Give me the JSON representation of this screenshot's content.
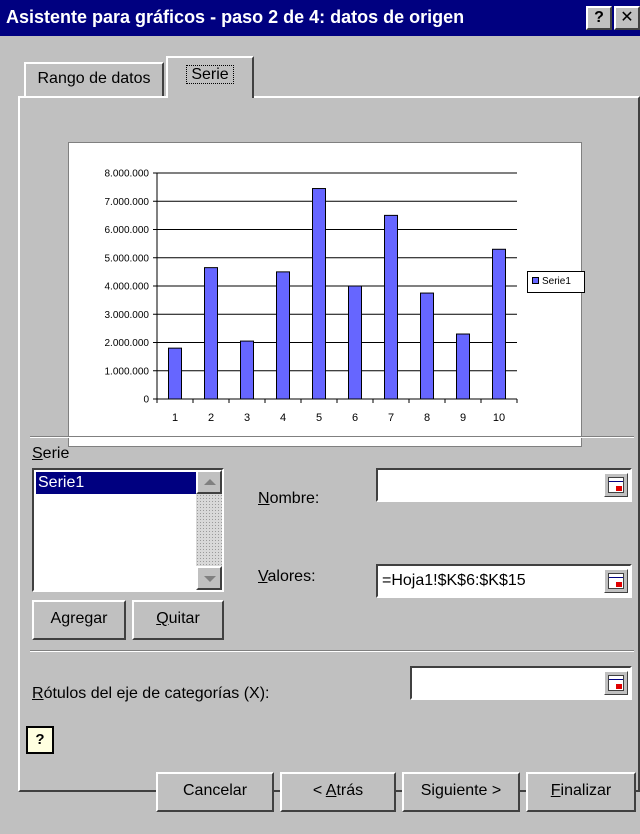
{
  "window": {
    "title": "Asistente para gráficos - paso 2 de 4: datos de origen",
    "help_label": "?",
    "close_label": "✕"
  },
  "tabs": [
    {
      "label": "Rango de datos",
      "selected": false
    },
    {
      "label": "Serie",
      "selected": true
    }
  ],
  "chart_data": {
    "type": "bar",
    "categories": [
      "1",
      "2",
      "3",
      "4",
      "5",
      "6",
      "7",
      "8",
      "9",
      "10"
    ],
    "series": [
      {
        "name": "Serie1",
        "color": "#6666ff",
        "values": [
          1800000,
          4650000,
          2050000,
          4500000,
          7450000,
          4000000,
          6500000,
          3750000,
          2300000,
          5300000
        ]
      }
    ],
    "ylim": [
      0,
      8000000
    ],
    "yticks": [
      "0",
      "1.000.000",
      "2.000.000",
      "3.000.000",
      "4.000.000",
      "5.000.000",
      "6.000.000",
      "7.000.000",
      "8.000.000"
    ],
    "grid": true,
    "legend": "right"
  },
  "series_section": {
    "heading": "Serie",
    "heading_mnemonic": "S",
    "heading_rest": "erie",
    "items": [
      "Serie1"
    ],
    "selected_index": 0
  },
  "buttons": {
    "add": {
      "before": "A",
      "mnemonic": "g",
      "after": "regar"
    },
    "remove": {
      "before": "",
      "mnemonic": "Q",
      "after": "uitar"
    }
  },
  "fields": {
    "name": {
      "label_mnemonic": "N",
      "label_rest": "ombre:",
      "value": ""
    },
    "values": {
      "label_mnemonic": "V",
      "label_rest": "alores:",
      "value": "=Hoja1!$K$6:$K$15"
    },
    "category_labels": {
      "label_mnemonic": "R",
      "label_rest": "ótulos del eje de categorías (X):",
      "value": ""
    }
  },
  "footer": {
    "help_icon": "?",
    "cancel": {
      "before": "Cancelar",
      "mnemonic": "",
      "after": ""
    },
    "back": {
      "before": "< ",
      "mnemonic": "A",
      "after": "trás"
    },
    "next": {
      "before": "Siguiente >",
      "mnemonic": "",
      "after": ""
    },
    "finish": {
      "before": "",
      "mnemonic": "F",
      "after": "inalizar"
    }
  }
}
